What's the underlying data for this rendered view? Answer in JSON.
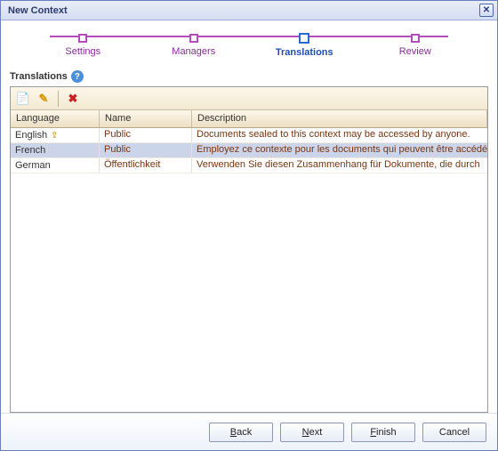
{
  "window": {
    "title": "New Context"
  },
  "steps": {
    "items": [
      {
        "label": "Settings"
      },
      {
        "label": "Managers"
      },
      {
        "label": "Translations"
      },
      {
        "label": "Review"
      }
    ],
    "current_index": 2
  },
  "section": {
    "title": "Translations"
  },
  "grid": {
    "columns": {
      "language": "Language",
      "name": "Name",
      "description": "Description"
    },
    "rows": [
      {
        "language": "English",
        "is_default": true,
        "name": "Public",
        "description": "Documents sealed to this context may be accessed by anyone."
      },
      {
        "language": "French",
        "is_default": false,
        "name": "Public",
        "description": "Employez ce contexte pour les documents qui peuvent être accédés"
      },
      {
        "language": "German",
        "is_default": false,
        "name": "Öffentlichkeit",
        "description": "Verwenden Sie diesen Zusammenhang für Dokumente, die durch "
      }
    ],
    "selected_index": 1
  },
  "toolbar": {
    "new": "new",
    "edit": "edit",
    "delete": "delete"
  },
  "buttons": {
    "back": "Back",
    "next": "Next",
    "finish": "Finish",
    "cancel": "Cancel"
  },
  "icons": {
    "new_glyph": "📄",
    "edit_glyph": "✎",
    "delete_glyph": "✖",
    "help_glyph": "?"
  },
  "colors": {
    "wizard_accent": "#b24dba",
    "current_step": "#2a6ad0",
    "hyperlink_text": "#7a3510"
  }
}
